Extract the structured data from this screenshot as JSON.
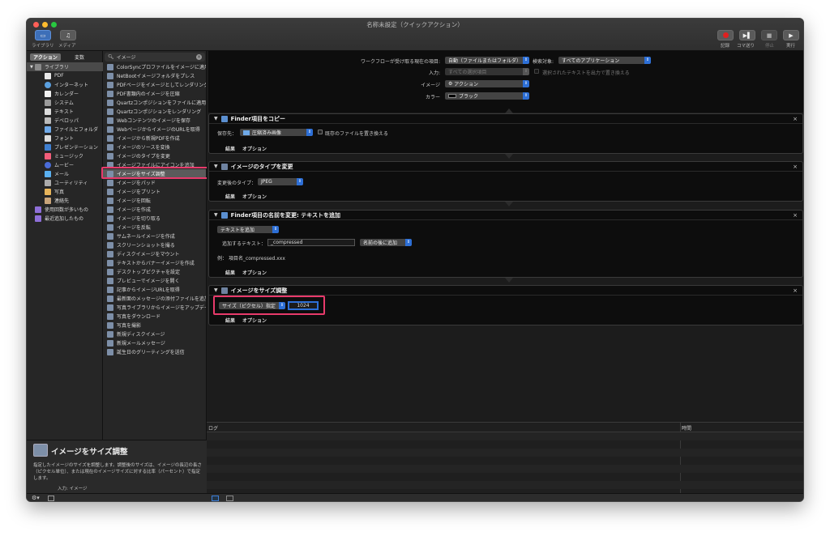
{
  "window": {
    "title": "名称未設定（クイックアクション）",
    "toolbar_left": [
      {
        "label": "ライブラリ",
        "icon": "library-icon"
      },
      {
        "label": "メディア",
        "icon": "music-note-icon"
      }
    ],
    "toolbar_right": [
      {
        "label": "記録",
        "icon": "record-icon"
      },
      {
        "label": "コマ送り",
        "icon": "step-icon"
      },
      {
        "label": "停止",
        "icon": "stop-icon"
      },
      {
        "label": "実行",
        "icon": "play-icon"
      }
    ]
  },
  "library": {
    "tabs": [
      "アクション",
      "変数"
    ],
    "root": "ライブラリ",
    "items": [
      "PDF",
      "インターネット",
      "カレンダー",
      "システム",
      "テキスト",
      "デベロッパ",
      "ファイルとフォルダ",
      "フォント",
      "プレゼンテーション",
      "ミュージック",
      "ムービー",
      "メール",
      "ユーティリティ",
      "写真",
      "連絡先"
    ],
    "special": [
      "使用回数が多いもの",
      "最近追加したもの"
    ]
  },
  "search": {
    "value": "イメージ"
  },
  "actions": {
    "items": [
      "ColorSyncプロファイルをイメージに適用",
      "NetBootイメージフォルダをプレス",
      "PDFページをイメージとしてレンダリング",
      "PDF書類内のイメージを圧縮",
      "Quartzコンポジションをファイルに適用",
      "Quartzコンポジションをレンダリング",
      "Webコンテンツのイメージを保存",
      "WebページからイメージのURLを取得",
      "イメージから新規PDFを作成",
      "イメージのソースを変換",
      "イメージのタイプを変更",
      "イメージファイルにアイコンを追加",
      "イメージをサイズ調整",
      "イメージをパッド",
      "イメージをプリント",
      "イメージを回転",
      "イメージを作成",
      "イメージを切り取る",
      "イメージを反転",
      "サムネールイメージを作成",
      "スクリーンショットを撮る",
      "ディスクイメージをマウント",
      "テキストからバナーイメージを作成",
      "デスクトップピクチャを設定",
      "プレビューでイメージを開く",
      "記事からイメージURLを取得",
      "最新面のメッセージの添付ファイルを追加",
      "写真ライブラリからイメージをアップデート",
      "写真をダウンロード",
      "写真を撮影",
      "新規ディスクイメージ",
      "新規メールメッセージ",
      "誕生日のグリーティングを送信"
    ],
    "selected": "イメージをサイズ調整"
  },
  "description": {
    "title": "イメージをサイズ調整",
    "text": "指定したイメージのサイズを調整します。調整後のサイズは、イメージの長辺の長さ（ピクセル単位）、または現在のイメージサイズに対する比率（パーセント）で指定します。",
    "input_label": "入力:",
    "input_value": "イメージ"
  },
  "workflow_config": {
    "receives_label": "ワークフローが受け取る現在の項目:",
    "receives_value": "自動（ファイルまたはフォルダ）",
    "search_target_label": "検索対象:",
    "search_target_value": "すべてのアプリケーション",
    "input_label": "入力:",
    "input_value": "すべての選択項目",
    "replace_label": "選択されたテキストを出力で置き換える",
    "image_label": "イメージ",
    "image_value": "アクション",
    "color_label": "カラー",
    "color_value": "ブラック"
  },
  "blocks": [
    {
      "title": "Finder項目をコピー",
      "save_label": "保存先：",
      "save_value": "圧縮済み画像",
      "replace_label": "既存のファイルを置き換える"
    },
    {
      "title": "イメージのタイプを変更",
      "type_label": "変更後のタイプ：",
      "type_value": "JPEG"
    },
    {
      "title": "Finder項目の名前を変更: テキストを追加",
      "mode_value": "テキストを追加",
      "add_text_label": "追加するテキスト：",
      "add_text_value": "_compressed",
      "position_value": "名前の後に追加",
      "example_label": "例：",
      "example_value": "項目名_compressed.xxx"
    },
    {
      "title": "イメージをサイズ調整",
      "size_mode": "サイズ（ピクセル）指定",
      "size_value": "1024"
    }
  ],
  "footer": {
    "results": "結果",
    "options": "オプション"
  },
  "log": {
    "col_log": "ログ",
    "col_time": "時間"
  },
  "colors": {
    "highlight": "#e83a6b",
    "accent": "#2d6fd6"
  }
}
